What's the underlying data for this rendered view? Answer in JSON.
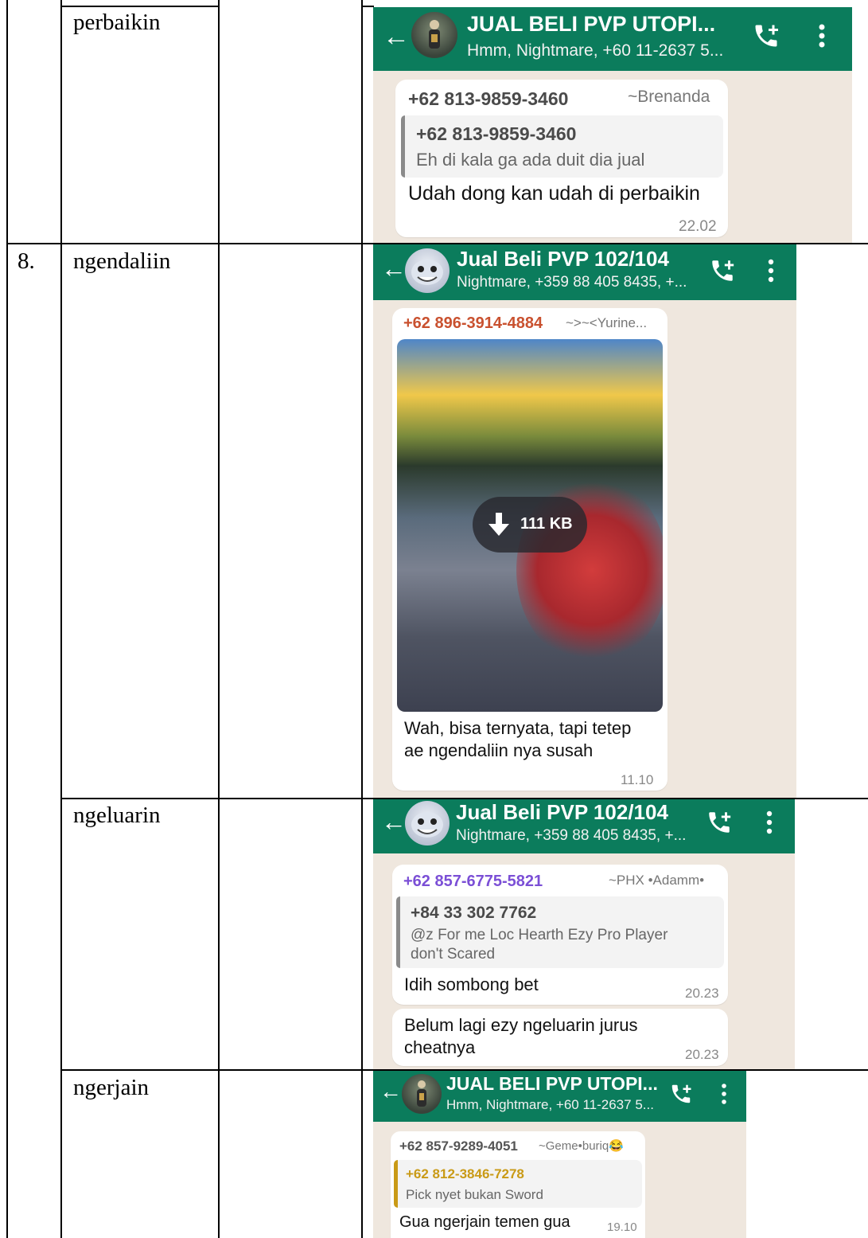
{
  "rows": [
    {
      "num": "",
      "word": "perbaikin"
    },
    {
      "num": "8.",
      "word": "ngendaliin"
    },
    {
      "num": "",
      "word": "ngeluarin"
    },
    {
      "num": "",
      "word": "ngerjain"
    }
  ],
  "shot1": {
    "title": "JUAL BELI PVP UTOPI...",
    "subtitle": "Hmm, Nightmare, +60 11-2637 5...",
    "sender": "+62 813-9859-3460",
    "alias": "~Brenanda",
    "quote_name": "+62 813-9859-3460",
    "quote_text": "Eh di kala ga ada duit dia jual",
    "message": "Udah dong kan udah di perbaikin",
    "time": "22.02"
  },
  "shot2": {
    "title": "Jual Beli PVP 102/104",
    "subtitle": "Nightmare, +359 88 405 8435, +...",
    "sender": "+62 896-3914-4884",
    "alias": "~>~<Yurine...",
    "download_size": "111 KB",
    "message_line1": "Wah, bisa ternyata, tapi tetep",
    "message_line2": "ae ngendaliin nya susah",
    "time": "11.10"
  },
  "shot3": {
    "title": "Jual Beli PVP 102/104",
    "subtitle": "Nightmare, +359 88 405 8435, +...",
    "sender": "+62 857-6775-5821",
    "alias": "~PHX •Adamm•",
    "quote_name": "+84 33 302 7762",
    "quote_line1": "@z For me Loc Hearth Ezy Pro Player",
    "quote_line2": "don't Scared",
    "message1": "Idih sombong bet",
    "time1": "20.23",
    "message2_line1": "Belum lagi ezy ngeluarin jurus",
    "message2_line2": "cheatnya",
    "time2": "20.23"
  },
  "shot4": {
    "title": "JUAL BELI PVP UTOPI...",
    "subtitle": "Hmm, Nightmare, +60 11-2637 5...",
    "sender": "+62 857-9289-4051",
    "alias": "~Geme•buriq😂",
    "quote_name": "+62 812-3846-7278",
    "quote_text": "Pick nyet bukan Sword",
    "message": "Gua ngerjain temen gua",
    "time": "19.10"
  },
  "colors": {
    "header_green": "#0b7c5c",
    "sender2": "#c9512f",
    "sender3": "#7b4fd6",
    "quote4": "#c99a16"
  }
}
